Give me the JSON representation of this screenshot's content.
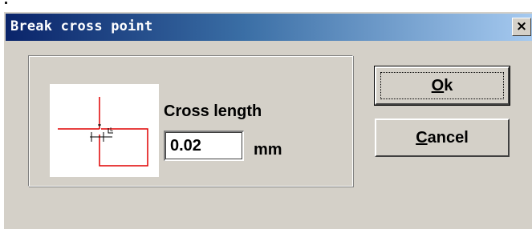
{
  "window": {
    "title": "Break cross point",
    "close_glyph": "×"
  },
  "form": {
    "cross_length_label": "Cross length",
    "cross_length_value": "0.02",
    "unit": "mm",
    "diagram_label": "L"
  },
  "buttons": {
    "ok": {
      "accel": "O",
      "rest": "k"
    },
    "cancel": {
      "accel": "C",
      "rest": "ancel"
    }
  },
  "colors": {
    "title_gradient_start": "#0a246a",
    "title_gradient_end": "#a6caf0",
    "dialog_face": "#d4d0c8",
    "diagram_line": "#e00000"
  }
}
